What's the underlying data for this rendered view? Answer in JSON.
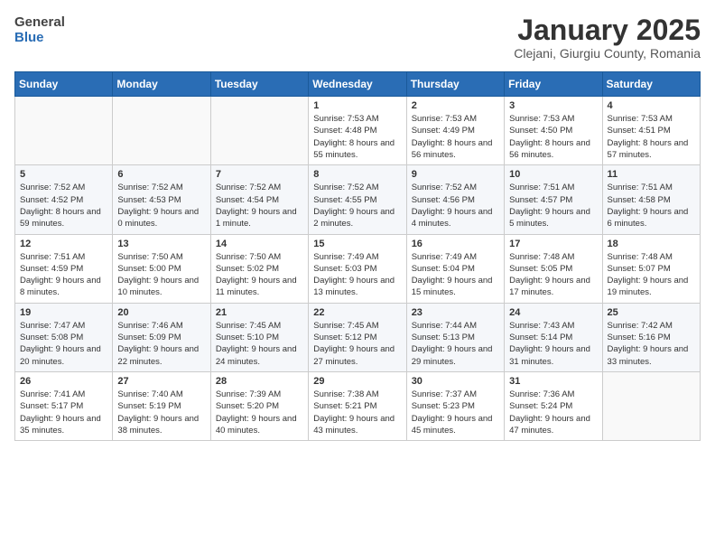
{
  "header": {
    "logo_general": "General",
    "logo_blue": "Blue",
    "title": "January 2025",
    "subtitle": "Clejani, Giurgiu County, Romania"
  },
  "weekdays": [
    "Sunday",
    "Monday",
    "Tuesday",
    "Wednesday",
    "Thursday",
    "Friday",
    "Saturday"
  ],
  "weeks": [
    [
      {
        "day": "",
        "sunrise": "",
        "sunset": "",
        "daylight": ""
      },
      {
        "day": "",
        "sunrise": "",
        "sunset": "",
        "daylight": ""
      },
      {
        "day": "",
        "sunrise": "",
        "sunset": "",
        "daylight": ""
      },
      {
        "day": "1",
        "sunrise": "Sunrise: 7:53 AM",
        "sunset": "Sunset: 4:48 PM",
        "daylight": "Daylight: 8 hours and 55 minutes."
      },
      {
        "day": "2",
        "sunrise": "Sunrise: 7:53 AM",
        "sunset": "Sunset: 4:49 PM",
        "daylight": "Daylight: 8 hours and 56 minutes."
      },
      {
        "day": "3",
        "sunrise": "Sunrise: 7:53 AM",
        "sunset": "Sunset: 4:50 PM",
        "daylight": "Daylight: 8 hours and 56 minutes."
      },
      {
        "day": "4",
        "sunrise": "Sunrise: 7:53 AM",
        "sunset": "Sunset: 4:51 PM",
        "daylight": "Daylight: 8 hours and 57 minutes."
      }
    ],
    [
      {
        "day": "5",
        "sunrise": "Sunrise: 7:52 AM",
        "sunset": "Sunset: 4:52 PM",
        "daylight": "Daylight: 8 hours and 59 minutes."
      },
      {
        "day": "6",
        "sunrise": "Sunrise: 7:52 AM",
        "sunset": "Sunset: 4:53 PM",
        "daylight": "Daylight: 9 hours and 0 minutes."
      },
      {
        "day": "7",
        "sunrise": "Sunrise: 7:52 AM",
        "sunset": "Sunset: 4:54 PM",
        "daylight": "Daylight: 9 hours and 1 minute."
      },
      {
        "day": "8",
        "sunrise": "Sunrise: 7:52 AM",
        "sunset": "Sunset: 4:55 PM",
        "daylight": "Daylight: 9 hours and 2 minutes."
      },
      {
        "day": "9",
        "sunrise": "Sunrise: 7:52 AM",
        "sunset": "Sunset: 4:56 PM",
        "daylight": "Daylight: 9 hours and 4 minutes."
      },
      {
        "day": "10",
        "sunrise": "Sunrise: 7:51 AM",
        "sunset": "Sunset: 4:57 PM",
        "daylight": "Daylight: 9 hours and 5 minutes."
      },
      {
        "day": "11",
        "sunrise": "Sunrise: 7:51 AM",
        "sunset": "Sunset: 4:58 PM",
        "daylight": "Daylight: 9 hours and 6 minutes."
      }
    ],
    [
      {
        "day": "12",
        "sunrise": "Sunrise: 7:51 AM",
        "sunset": "Sunset: 4:59 PM",
        "daylight": "Daylight: 9 hours and 8 minutes."
      },
      {
        "day": "13",
        "sunrise": "Sunrise: 7:50 AM",
        "sunset": "Sunset: 5:00 PM",
        "daylight": "Daylight: 9 hours and 10 minutes."
      },
      {
        "day": "14",
        "sunrise": "Sunrise: 7:50 AM",
        "sunset": "Sunset: 5:02 PM",
        "daylight": "Daylight: 9 hours and 11 minutes."
      },
      {
        "day": "15",
        "sunrise": "Sunrise: 7:49 AM",
        "sunset": "Sunset: 5:03 PM",
        "daylight": "Daylight: 9 hours and 13 minutes."
      },
      {
        "day": "16",
        "sunrise": "Sunrise: 7:49 AM",
        "sunset": "Sunset: 5:04 PM",
        "daylight": "Daylight: 9 hours and 15 minutes."
      },
      {
        "day": "17",
        "sunrise": "Sunrise: 7:48 AM",
        "sunset": "Sunset: 5:05 PM",
        "daylight": "Daylight: 9 hours and 17 minutes."
      },
      {
        "day": "18",
        "sunrise": "Sunrise: 7:48 AM",
        "sunset": "Sunset: 5:07 PM",
        "daylight": "Daylight: 9 hours and 19 minutes."
      }
    ],
    [
      {
        "day": "19",
        "sunrise": "Sunrise: 7:47 AM",
        "sunset": "Sunset: 5:08 PM",
        "daylight": "Daylight: 9 hours and 20 minutes."
      },
      {
        "day": "20",
        "sunrise": "Sunrise: 7:46 AM",
        "sunset": "Sunset: 5:09 PM",
        "daylight": "Daylight: 9 hours and 22 minutes."
      },
      {
        "day": "21",
        "sunrise": "Sunrise: 7:45 AM",
        "sunset": "Sunset: 5:10 PM",
        "daylight": "Daylight: 9 hours and 24 minutes."
      },
      {
        "day": "22",
        "sunrise": "Sunrise: 7:45 AM",
        "sunset": "Sunset: 5:12 PM",
        "daylight": "Daylight: 9 hours and 27 minutes."
      },
      {
        "day": "23",
        "sunrise": "Sunrise: 7:44 AM",
        "sunset": "Sunset: 5:13 PM",
        "daylight": "Daylight: 9 hours and 29 minutes."
      },
      {
        "day": "24",
        "sunrise": "Sunrise: 7:43 AM",
        "sunset": "Sunset: 5:14 PM",
        "daylight": "Daylight: 9 hours and 31 minutes."
      },
      {
        "day": "25",
        "sunrise": "Sunrise: 7:42 AM",
        "sunset": "Sunset: 5:16 PM",
        "daylight": "Daylight: 9 hours and 33 minutes."
      }
    ],
    [
      {
        "day": "26",
        "sunrise": "Sunrise: 7:41 AM",
        "sunset": "Sunset: 5:17 PM",
        "daylight": "Daylight: 9 hours and 35 minutes."
      },
      {
        "day": "27",
        "sunrise": "Sunrise: 7:40 AM",
        "sunset": "Sunset: 5:19 PM",
        "daylight": "Daylight: 9 hours and 38 minutes."
      },
      {
        "day": "28",
        "sunrise": "Sunrise: 7:39 AM",
        "sunset": "Sunset: 5:20 PM",
        "daylight": "Daylight: 9 hours and 40 minutes."
      },
      {
        "day": "29",
        "sunrise": "Sunrise: 7:38 AM",
        "sunset": "Sunset: 5:21 PM",
        "daylight": "Daylight: 9 hours and 43 minutes."
      },
      {
        "day": "30",
        "sunrise": "Sunrise: 7:37 AM",
        "sunset": "Sunset: 5:23 PM",
        "daylight": "Daylight: 9 hours and 45 minutes."
      },
      {
        "day": "31",
        "sunrise": "Sunrise: 7:36 AM",
        "sunset": "Sunset: 5:24 PM",
        "daylight": "Daylight: 9 hours and 47 minutes."
      },
      {
        "day": "",
        "sunrise": "",
        "sunset": "",
        "daylight": ""
      }
    ]
  ]
}
